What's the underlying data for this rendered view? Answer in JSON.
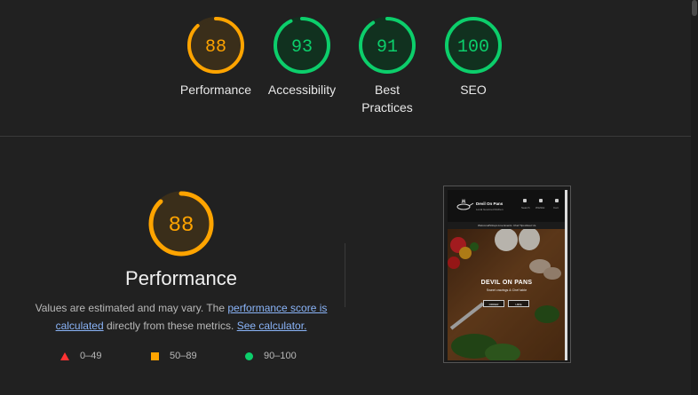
{
  "scores": [
    {
      "value": "88",
      "label_lines": [
        "Performance"
      ],
      "status": "average",
      "fraction": 0.88
    },
    {
      "value": "93",
      "label_lines": [
        "Accessibility"
      ],
      "status": "pass",
      "fraction": 0.93
    },
    {
      "value": "91",
      "label_lines": [
        "Best",
        "Practices"
      ],
      "status": "pass",
      "fraction": 0.91
    },
    {
      "value": "100",
      "label_lines": [
        "SEO"
      ],
      "status": "pass",
      "fraction": 1.0
    }
  ],
  "performance": {
    "score": "88",
    "fraction": 0.88,
    "title": "Performance",
    "desc_prefix": "Values are estimated and may vary. The ",
    "desc_link1": "performance score is calculated",
    "desc_middle": " directly from these metrics. ",
    "desc_link2": "See calculator.",
    "legend": [
      {
        "icon": "triangle-fail-icon",
        "range": "0–49"
      },
      {
        "icon": "square-average-icon",
        "range": "50–89"
      },
      {
        "icon": "circle-pass-icon",
        "range": "90–100"
      }
    ]
  },
  "screenshot": {
    "brand": "Devil On Pans",
    "subtitle": "Local Gourmet Kitchen",
    "hero_title": "DEVIL ON PANS",
    "hero_tagline": "Sweet cravings & Chef table",
    "btn_left": "ORDER",
    "btn_right": "HIRE",
    "header_icons": [
      "Search",
      "Wishlist",
      "Cart"
    ],
    "nav": [
      "Welcome",
      "Pickups",
      "Live Events",
      "Chef Tips",
      "About Us"
    ]
  },
  "colors": {
    "pass": "#0cce6b",
    "average": "#ffa400",
    "fail": "#ff3333",
    "pass_bg": "#11311f",
    "average_bg": "#3a2e1a"
  }
}
